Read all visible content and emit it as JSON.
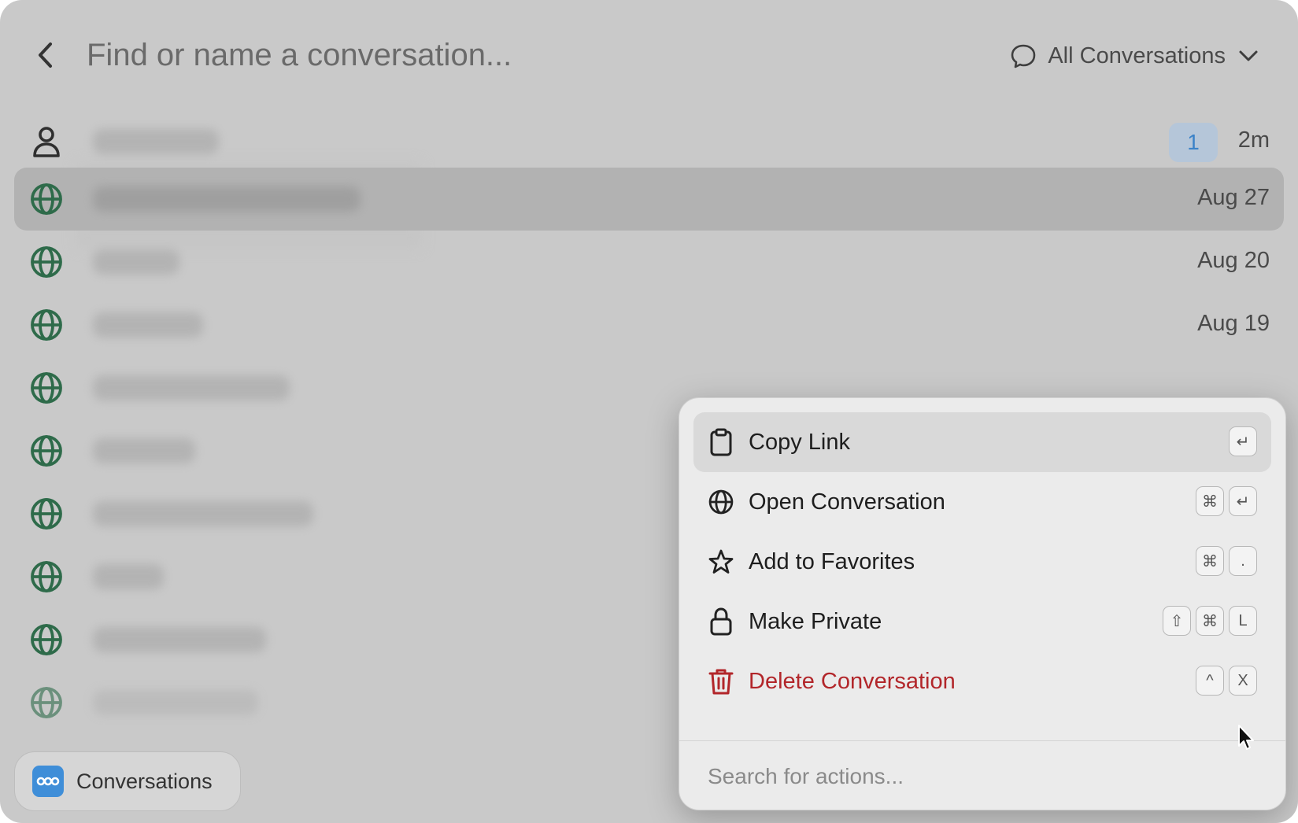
{
  "header": {
    "search_placeholder": "Find or name a conversation...",
    "filter_label": "All Conversations"
  },
  "conversations": [
    {
      "icon": "person-icon",
      "badge": "1",
      "date": "2m"
    },
    {
      "icon": "globe-icon",
      "date": "Aug 27",
      "selected": true
    },
    {
      "icon": "globe-icon",
      "date": "Aug 20"
    },
    {
      "icon": "globe-icon",
      "date": "Aug 19"
    },
    {
      "icon": "globe-icon",
      "date": ""
    },
    {
      "icon": "globe-icon",
      "date": ""
    },
    {
      "icon": "globe-icon",
      "date": ""
    },
    {
      "icon": "globe-icon",
      "date": ""
    },
    {
      "icon": "globe-icon",
      "date": ""
    },
    {
      "icon": "globe-icon",
      "date": ""
    }
  ],
  "bottom_bar": {
    "app_label": "Conversations"
  },
  "action_menu": {
    "items": [
      {
        "label": "Copy Link",
        "icon": "clipboard-icon",
        "keys": [
          "↵"
        ]
      },
      {
        "label": "Open Conversation",
        "icon": "globe-icon",
        "keys": [
          "⌘",
          "↵"
        ]
      },
      {
        "label": "Add to Favorites",
        "icon": "star-icon",
        "keys": [
          "⌘",
          "."
        ]
      },
      {
        "label": "Make Private",
        "icon": "lock-icon",
        "keys": [
          "⇧",
          "⌘",
          "L"
        ]
      },
      {
        "label": "Delete Conversation",
        "icon": "trash-icon",
        "keys": [
          "^",
          "X"
        ]
      }
    ],
    "search_placeholder": "Search for actions..."
  },
  "colors": {
    "globe": "#2e6b4a",
    "danger": "#b2262a",
    "badge_text": "#3b82c8",
    "app_icon": "#3f8ed8"
  }
}
